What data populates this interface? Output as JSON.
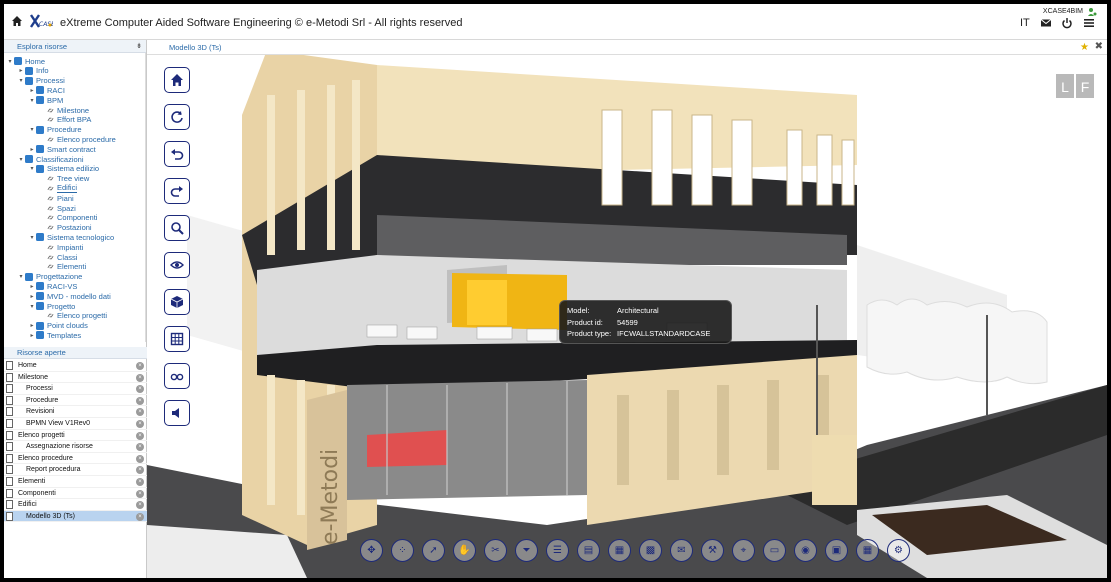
{
  "app": {
    "title": "eXtreme Computer Aided Software Engineering © e-Metodi Srl - All rights reserved",
    "user": "XCASE4BIM",
    "lang": "IT"
  },
  "explorer": {
    "title": "Esplora risorse",
    "items": [
      {
        "label": "Home",
        "level": 0,
        "toggle": "▾",
        "kind": "tag"
      },
      {
        "label": "Info",
        "level": 1,
        "toggle": "▸",
        "kind": "tag"
      },
      {
        "label": "Processi",
        "level": 1,
        "toggle": "▾",
        "kind": "tag"
      },
      {
        "label": "RACI",
        "level": 2,
        "toggle": "▸",
        "kind": "tag"
      },
      {
        "label": "BPM",
        "level": 2,
        "toggle": "▾",
        "kind": "tag"
      },
      {
        "label": "Milestone",
        "level": 3,
        "toggle": "",
        "kind": "link"
      },
      {
        "label": "Effort BPA",
        "level": 3,
        "toggle": "",
        "kind": "link"
      },
      {
        "label": "Procedure",
        "level": 2,
        "toggle": "▾",
        "kind": "tag"
      },
      {
        "label": "Elenco procedure",
        "level": 3,
        "toggle": "",
        "kind": "link"
      },
      {
        "label": "Smart contract",
        "level": 2,
        "toggle": "▸",
        "kind": "tag"
      },
      {
        "label": "Classificazioni",
        "level": 1,
        "toggle": "▾",
        "kind": "tag"
      },
      {
        "label": "Sistema edilizio",
        "level": 2,
        "toggle": "▾",
        "kind": "tag"
      },
      {
        "label": "Tree view",
        "level": 3,
        "toggle": "",
        "kind": "link"
      },
      {
        "label": "Edifici",
        "level": 3,
        "toggle": "",
        "kind": "link",
        "selected": true
      },
      {
        "label": "Piani",
        "level": 3,
        "toggle": "",
        "kind": "link"
      },
      {
        "label": "Spazi",
        "level": 3,
        "toggle": "",
        "kind": "link"
      },
      {
        "label": "Componenti",
        "level": 3,
        "toggle": "",
        "kind": "link"
      },
      {
        "label": "Postazioni",
        "level": 3,
        "toggle": "",
        "kind": "link"
      },
      {
        "label": "Sistema tecnologico",
        "level": 2,
        "toggle": "▾",
        "kind": "tag"
      },
      {
        "label": "Impianti",
        "level": 3,
        "toggle": "",
        "kind": "link"
      },
      {
        "label": "Classi",
        "level": 3,
        "toggle": "",
        "kind": "link"
      },
      {
        "label": "Elementi",
        "level": 3,
        "toggle": "",
        "kind": "link"
      },
      {
        "label": "Progettazione",
        "level": 1,
        "toggle": "▾",
        "kind": "tag"
      },
      {
        "label": "RACI-VS",
        "level": 2,
        "toggle": "▸",
        "kind": "tag"
      },
      {
        "label": "MVD - modello dati",
        "level": 2,
        "toggle": "▸",
        "kind": "tag"
      },
      {
        "label": "Progetto",
        "level": 2,
        "toggle": "▾",
        "kind": "tag"
      },
      {
        "label": "Elenco progetti",
        "level": 3,
        "toggle": "",
        "kind": "link"
      },
      {
        "label": "Point clouds",
        "level": 2,
        "toggle": "▸",
        "kind": "tag"
      },
      {
        "label": "Templates",
        "level": 2,
        "toggle": "▸",
        "kind": "tag"
      }
    ]
  },
  "open_resources": {
    "title": "Risorse aperte",
    "items": [
      {
        "label": "Home",
        "level": 0
      },
      {
        "label": "Milestone",
        "level": 0
      },
      {
        "label": "Processi",
        "level": 1
      },
      {
        "label": "Procedure",
        "level": 1
      },
      {
        "label": "Revisioni",
        "level": 1
      },
      {
        "label": "BPMN View V1Rev0",
        "level": 1
      },
      {
        "label": "Elenco progetti",
        "level": 0
      },
      {
        "label": "Assegnazione risorse",
        "level": 1
      },
      {
        "label": "Elenco procedure",
        "level": 0
      },
      {
        "label": "Report procedura",
        "level": 1
      },
      {
        "label": "Elementi",
        "level": 0
      },
      {
        "label": "Componenti",
        "level": 0
      },
      {
        "label": "Edifici",
        "level": 0
      },
      {
        "label": "Modello 3D (Ts)",
        "level": 1,
        "active": true
      }
    ]
  },
  "main": {
    "tab_title": "Modello 3D (Ts)",
    "brand_badge": [
      "L",
      "F"
    ],
    "facade_text": "e-Metodi",
    "tooltip": {
      "rows": [
        {
          "key": "Model:",
          "value": "Architectural"
        },
        {
          "key": "Product id:",
          "value": "54599"
        },
        {
          "key": "Product type:",
          "value": "IFCWALLSTANDARDCASE"
        }
      ]
    },
    "left_tools": [
      "home-view",
      "rotate",
      "undo",
      "redo",
      "zoom",
      "orbit",
      "cube-view",
      "grid-view",
      "glasses-view",
      "speaker"
    ],
    "bottom_tools": [
      "move",
      "select-points",
      "pointer-select",
      "hand-select",
      "cut",
      "filter",
      "list-details",
      "clipboard",
      "document",
      "grid-select",
      "comment",
      "wrench",
      "marker",
      "card",
      "camera",
      "image",
      "calendar",
      "properties"
    ]
  },
  "colors": {
    "accent": "#2a6aa8",
    "tool_border": "#1d2a7a",
    "active_row": "#b9d3ef",
    "sky": "#ffffff",
    "facade": "#ecd9b0",
    "slab": "#2f2f31",
    "yellow_wall": "#f0b514",
    "red_wall": "#e05050"
  }
}
